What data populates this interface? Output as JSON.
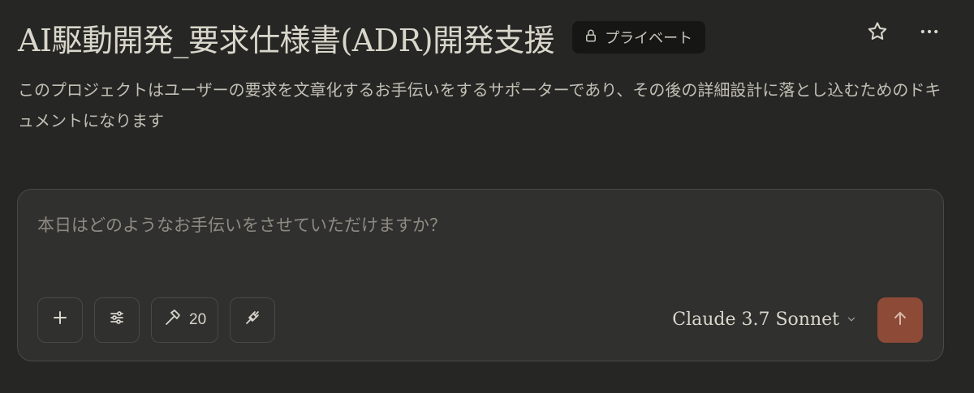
{
  "project": {
    "title": "AI駆動開発_要求仕様書(ADR)開発支援",
    "privacy_label": "プライベート",
    "description": "このプロジェクトはユーザーの要求を文章化するお手伝いをするサポーターであり、その後の詳細設計に落とし込むためのドキュメントになります"
  },
  "header_icons": {
    "lock": "lock-icon",
    "star": "star-icon",
    "more": "more-horizontal-icon"
  },
  "composer": {
    "placeholder": "本日はどのようなお手伝いをさせていただけますか？",
    "tools": {
      "add_icon": "plus-icon",
      "settings_icon": "sliders-icon",
      "tools_icon": "hammer-icon",
      "tools_count": "20",
      "integrations_icon": "plug-icon"
    },
    "model_label": "Claude 3.7 Sonnet",
    "send_icon": "arrow-up-icon"
  },
  "colors": {
    "background": "#262624",
    "composer": "#30302e",
    "badge": "#161614",
    "send_button": "#8c4a37",
    "text_primary": "#d9d6cb",
    "text_muted": "#8e8b83"
  }
}
